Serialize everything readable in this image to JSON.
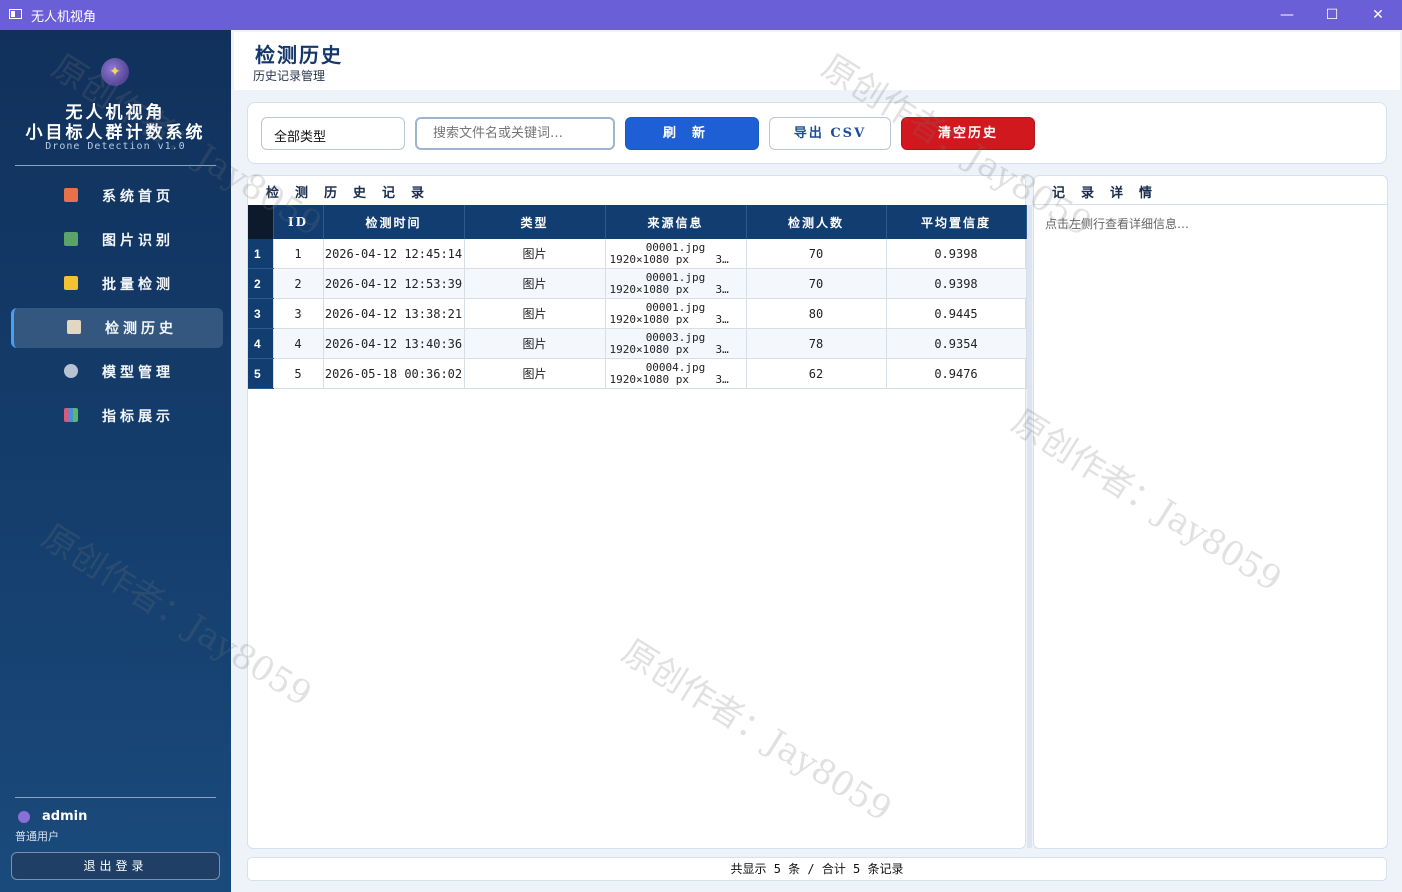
{
  "window": {
    "title": "无人机视角",
    "min": "—",
    "max": "☐",
    "close": "✕"
  },
  "sidebar": {
    "logo_icon": "crystal-ball-icon",
    "app_name_line1": "无人机视角",
    "app_name_line2": "小目标人群计数系统",
    "app_subtitle": "Drone Detection v1.0",
    "nav": [
      {
        "label": "系统首页",
        "icon": "home-icon",
        "color": "#e8704a"
      },
      {
        "label": "图片识别",
        "icon": "image-icon",
        "color": "#5aa36a"
      },
      {
        "label": "批量检测",
        "icon": "folder-icon",
        "color": "#f2c230"
      },
      {
        "label": "检测历史",
        "icon": "clipboard-icon",
        "color": "#e2d6c4",
        "active": true
      },
      {
        "label": "模型管理",
        "icon": "gear-icon",
        "color": "#b7c3d2"
      },
      {
        "label": "指标展示",
        "icon": "bar-chart-icon",
        "color": "#d85a7a"
      }
    ],
    "user": {
      "name": "admin",
      "role": "普通用户"
    },
    "logout_label": "退出登录"
  },
  "header": {
    "title": "检测历史",
    "subtitle": "历史记录管理"
  },
  "toolbar": {
    "type_select": "全部类型",
    "search_placeholder": "搜索文件名或关键词…",
    "refresh_label": "刷新",
    "export_label": "导出 CSV",
    "clear_label": "清空历史"
  },
  "history": {
    "title": "检测历史记录",
    "columns": [
      "ID",
      "检测时间",
      "类型",
      "来源信息",
      "检测人数",
      "平均置信度"
    ],
    "rows": [
      {
        "num": "1",
        "id": "1",
        "time": "2026-04-12 12:45:14",
        "type": "图片",
        "src1": "00001.jpg",
        "src2": "1920×1080 px    3…",
        "count": "70",
        "conf": "0.9398"
      },
      {
        "num": "2",
        "id": "2",
        "time": "2026-04-12 12:53:39",
        "type": "图片",
        "src1": "00001.jpg",
        "src2": "1920×1080 px    3…",
        "count": "70",
        "conf": "0.9398"
      },
      {
        "num": "3",
        "id": "3",
        "time": "2026-04-12 13:38:21",
        "type": "图片",
        "src1": "00001.jpg",
        "src2": "1920×1080 px    3…",
        "count": "80",
        "conf": "0.9445"
      },
      {
        "num": "4",
        "id": "4",
        "time": "2026-04-12 13:40:36",
        "type": "图片",
        "src1": "00003.jpg",
        "src2": "1920×1080 px    3…",
        "count": "78",
        "conf": "0.9354"
      },
      {
        "num": "5",
        "id": "5",
        "time": "2026-05-18 00:36:02",
        "type": "图片",
        "src1": "00004.jpg",
        "src2": "1920×1080 px    3…",
        "count": "62",
        "conf": "0.9476"
      }
    ]
  },
  "detail": {
    "title": "记录详情",
    "placeholder": "点击左侧行查看详细信息…"
  },
  "status": {
    "text": "共显示 5 条 / 合计 5 条记录"
  },
  "watermark": "原创作者：Jay8059"
}
